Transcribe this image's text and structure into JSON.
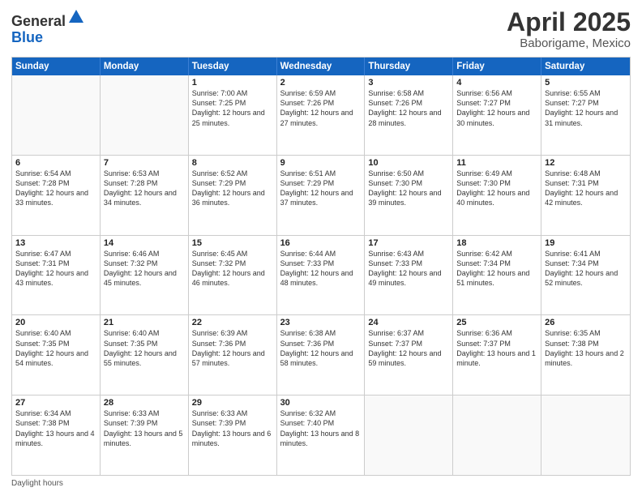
{
  "header": {
    "logo_general": "General",
    "logo_blue": "Blue",
    "title": "April 2025",
    "location": "Baborigame, Mexico"
  },
  "days_of_week": [
    "Sunday",
    "Monday",
    "Tuesday",
    "Wednesday",
    "Thursday",
    "Friday",
    "Saturday"
  ],
  "weeks": [
    [
      {
        "day": "",
        "sunrise": "",
        "sunset": "",
        "daylight": ""
      },
      {
        "day": "",
        "sunrise": "",
        "sunset": "",
        "daylight": ""
      },
      {
        "day": "1",
        "sunrise": "Sunrise: 7:00 AM",
        "sunset": "Sunset: 7:25 PM",
        "daylight": "Daylight: 12 hours and 25 minutes."
      },
      {
        "day": "2",
        "sunrise": "Sunrise: 6:59 AM",
        "sunset": "Sunset: 7:26 PM",
        "daylight": "Daylight: 12 hours and 27 minutes."
      },
      {
        "day": "3",
        "sunrise": "Sunrise: 6:58 AM",
        "sunset": "Sunset: 7:26 PM",
        "daylight": "Daylight: 12 hours and 28 minutes."
      },
      {
        "day": "4",
        "sunrise": "Sunrise: 6:56 AM",
        "sunset": "Sunset: 7:27 PM",
        "daylight": "Daylight: 12 hours and 30 minutes."
      },
      {
        "day": "5",
        "sunrise": "Sunrise: 6:55 AM",
        "sunset": "Sunset: 7:27 PM",
        "daylight": "Daylight: 12 hours and 31 minutes."
      }
    ],
    [
      {
        "day": "6",
        "sunrise": "Sunrise: 6:54 AM",
        "sunset": "Sunset: 7:28 PM",
        "daylight": "Daylight: 12 hours and 33 minutes."
      },
      {
        "day": "7",
        "sunrise": "Sunrise: 6:53 AM",
        "sunset": "Sunset: 7:28 PM",
        "daylight": "Daylight: 12 hours and 34 minutes."
      },
      {
        "day": "8",
        "sunrise": "Sunrise: 6:52 AM",
        "sunset": "Sunset: 7:29 PM",
        "daylight": "Daylight: 12 hours and 36 minutes."
      },
      {
        "day": "9",
        "sunrise": "Sunrise: 6:51 AM",
        "sunset": "Sunset: 7:29 PM",
        "daylight": "Daylight: 12 hours and 37 minutes."
      },
      {
        "day": "10",
        "sunrise": "Sunrise: 6:50 AM",
        "sunset": "Sunset: 7:30 PM",
        "daylight": "Daylight: 12 hours and 39 minutes."
      },
      {
        "day": "11",
        "sunrise": "Sunrise: 6:49 AM",
        "sunset": "Sunset: 7:30 PM",
        "daylight": "Daylight: 12 hours and 40 minutes."
      },
      {
        "day": "12",
        "sunrise": "Sunrise: 6:48 AM",
        "sunset": "Sunset: 7:31 PM",
        "daylight": "Daylight: 12 hours and 42 minutes."
      }
    ],
    [
      {
        "day": "13",
        "sunrise": "Sunrise: 6:47 AM",
        "sunset": "Sunset: 7:31 PM",
        "daylight": "Daylight: 12 hours and 43 minutes."
      },
      {
        "day": "14",
        "sunrise": "Sunrise: 6:46 AM",
        "sunset": "Sunset: 7:32 PM",
        "daylight": "Daylight: 12 hours and 45 minutes."
      },
      {
        "day": "15",
        "sunrise": "Sunrise: 6:45 AM",
        "sunset": "Sunset: 7:32 PM",
        "daylight": "Daylight: 12 hours and 46 minutes."
      },
      {
        "day": "16",
        "sunrise": "Sunrise: 6:44 AM",
        "sunset": "Sunset: 7:33 PM",
        "daylight": "Daylight: 12 hours and 48 minutes."
      },
      {
        "day": "17",
        "sunrise": "Sunrise: 6:43 AM",
        "sunset": "Sunset: 7:33 PM",
        "daylight": "Daylight: 12 hours and 49 minutes."
      },
      {
        "day": "18",
        "sunrise": "Sunrise: 6:42 AM",
        "sunset": "Sunset: 7:34 PM",
        "daylight": "Daylight: 12 hours and 51 minutes."
      },
      {
        "day": "19",
        "sunrise": "Sunrise: 6:41 AM",
        "sunset": "Sunset: 7:34 PM",
        "daylight": "Daylight: 12 hours and 52 minutes."
      }
    ],
    [
      {
        "day": "20",
        "sunrise": "Sunrise: 6:40 AM",
        "sunset": "Sunset: 7:35 PM",
        "daylight": "Daylight: 12 hours and 54 minutes."
      },
      {
        "day": "21",
        "sunrise": "Sunrise: 6:40 AM",
        "sunset": "Sunset: 7:35 PM",
        "daylight": "Daylight: 12 hours and 55 minutes."
      },
      {
        "day": "22",
        "sunrise": "Sunrise: 6:39 AM",
        "sunset": "Sunset: 7:36 PM",
        "daylight": "Daylight: 12 hours and 57 minutes."
      },
      {
        "day": "23",
        "sunrise": "Sunrise: 6:38 AM",
        "sunset": "Sunset: 7:36 PM",
        "daylight": "Daylight: 12 hours and 58 minutes."
      },
      {
        "day": "24",
        "sunrise": "Sunrise: 6:37 AM",
        "sunset": "Sunset: 7:37 PM",
        "daylight": "Daylight: 12 hours and 59 minutes."
      },
      {
        "day": "25",
        "sunrise": "Sunrise: 6:36 AM",
        "sunset": "Sunset: 7:37 PM",
        "daylight": "Daylight: 13 hours and 1 minute."
      },
      {
        "day": "26",
        "sunrise": "Sunrise: 6:35 AM",
        "sunset": "Sunset: 7:38 PM",
        "daylight": "Daylight: 13 hours and 2 minutes."
      }
    ],
    [
      {
        "day": "27",
        "sunrise": "Sunrise: 6:34 AM",
        "sunset": "Sunset: 7:38 PM",
        "daylight": "Daylight: 13 hours and 4 minutes."
      },
      {
        "day": "28",
        "sunrise": "Sunrise: 6:33 AM",
        "sunset": "Sunset: 7:39 PM",
        "daylight": "Daylight: 13 hours and 5 minutes."
      },
      {
        "day": "29",
        "sunrise": "Sunrise: 6:33 AM",
        "sunset": "Sunset: 7:39 PM",
        "daylight": "Daylight: 13 hours and 6 minutes."
      },
      {
        "day": "30",
        "sunrise": "Sunrise: 6:32 AM",
        "sunset": "Sunset: 7:40 PM",
        "daylight": "Daylight: 13 hours and 8 minutes."
      },
      {
        "day": "",
        "sunrise": "",
        "sunset": "",
        "daylight": ""
      },
      {
        "day": "",
        "sunrise": "",
        "sunset": "",
        "daylight": ""
      },
      {
        "day": "",
        "sunrise": "",
        "sunset": "",
        "daylight": ""
      }
    ]
  ],
  "footer": "Daylight hours"
}
